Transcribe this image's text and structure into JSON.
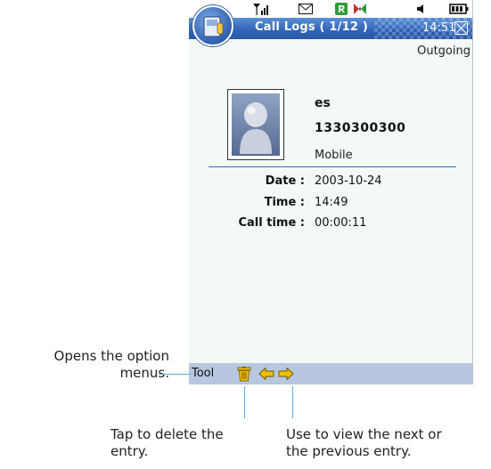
{
  "window": {
    "title": "Call Logs ( 1/12 )",
    "time": "14:51"
  },
  "call": {
    "direction": "Outgoing",
    "contact_name": "es",
    "number": "1330300300",
    "number_type": "Mobile",
    "details": [
      {
        "label": "Date :",
        "value": "2003-10-24"
      },
      {
        "label": "Time :",
        "value": "14:49"
      },
      {
        "label": "Call time :",
        "value": "00:00:11"
      }
    ]
  },
  "toolbar": {
    "tool_label": "Tool"
  },
  "annotations": {
    "tool": [
      "Opens the option",
      "menus."
    ],
    "delete": [
      "Tap to delete the",
      "entry."
    ],
    "navigate": [
      "Use to view the next or",
      "the previous entry."
    ]
  },
  "icons": {
    "status": [
      "signal-icon",
      "message-icon",
      "network-icon",
      "bluetooth-icon",
      "speaker-icon",
      "battery-icon"
    ],
    "toolbar": [
      "trash-icon",
      "arrow-left-icon",
      "arrow-right-icon"
    ]
  },
  "colors": {
    "titlebar": "#2f63b8",
    "toolbar": "#b7c7e0",
    "callout_line": "#5bb0e0",
    "icon_yellow": "#f0c000"
  }
}
